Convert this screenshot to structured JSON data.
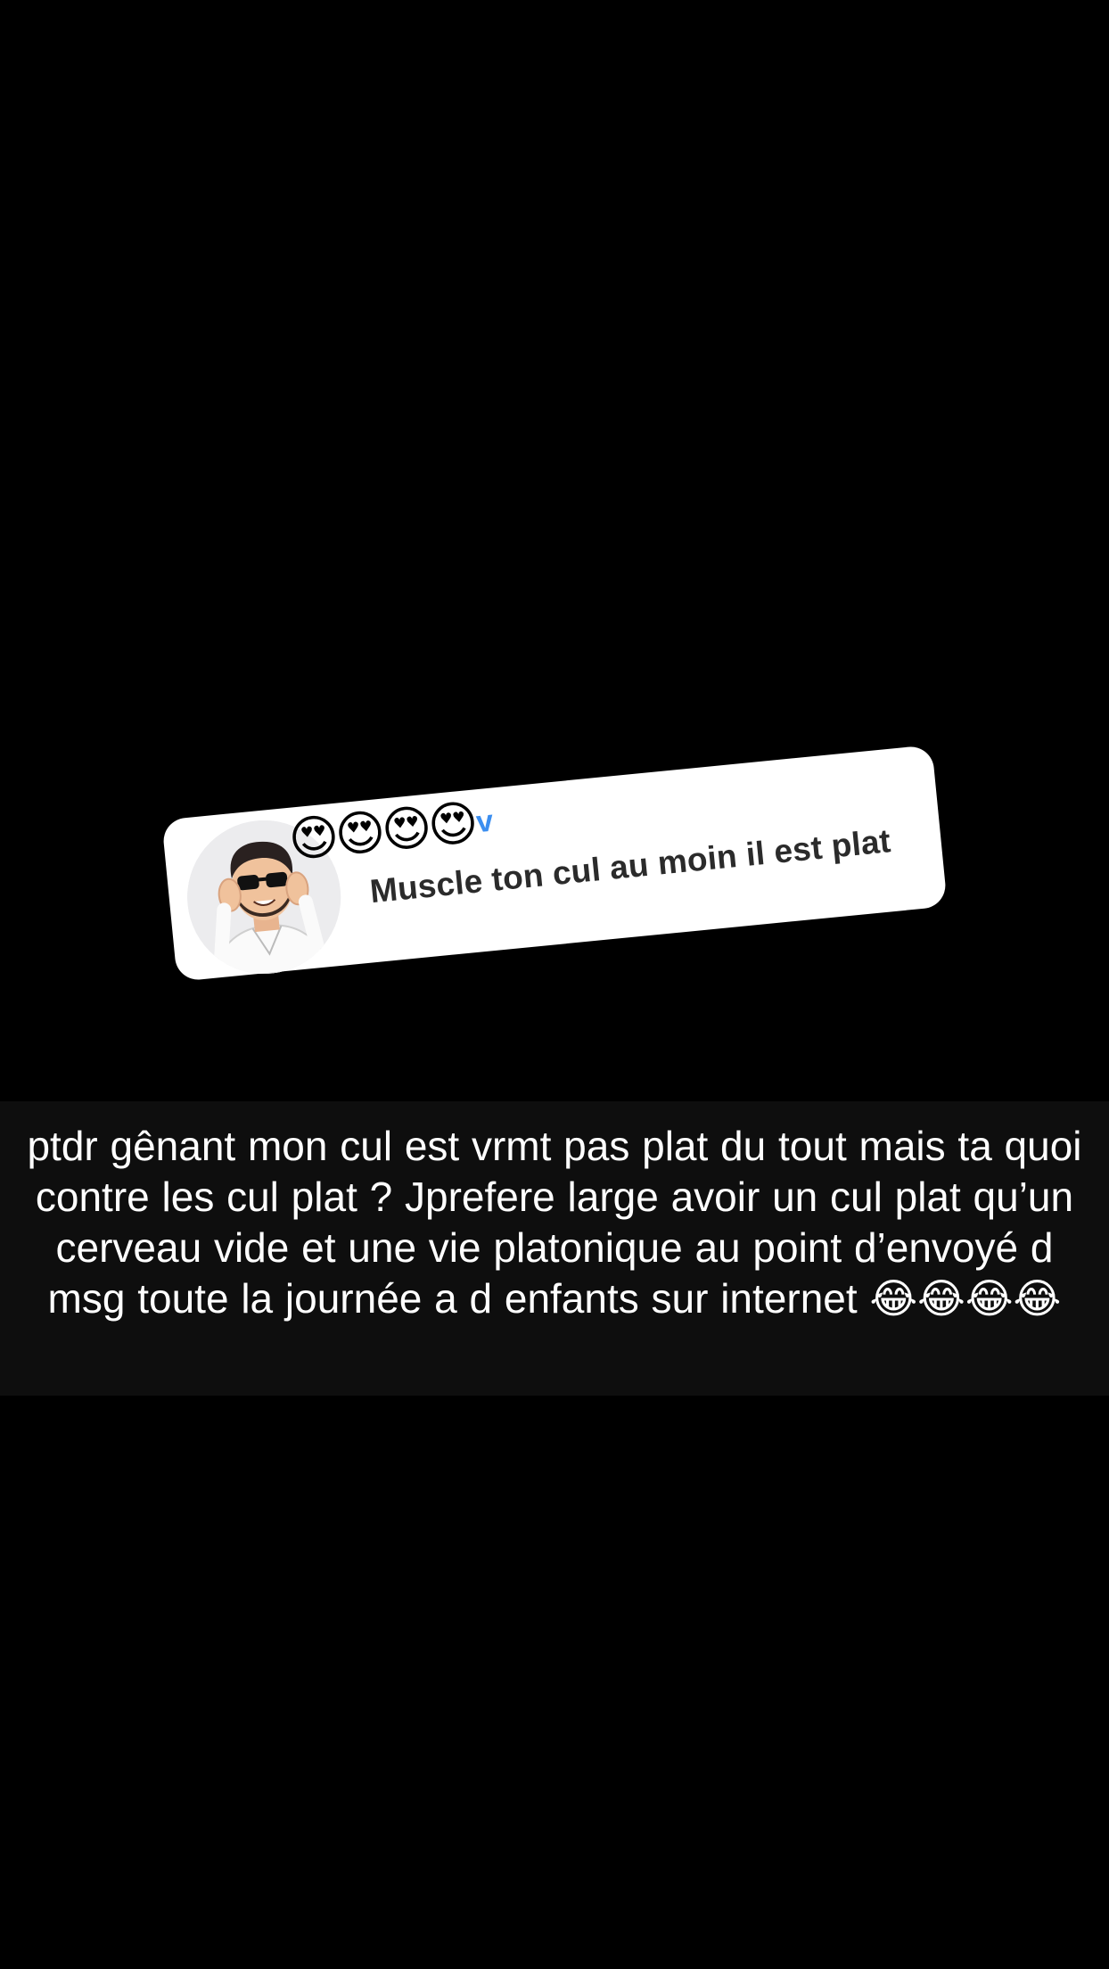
{
  "reply_sticker": {
    "username_emojis": [
      "😍",
      "😍",
      "😍",
      "😍"
    ],
    "username_suffix": "v",
    "question": "Muscle ton cul au moin il est plat"
  },
  "caption": {
    "text": "ptdr gênant mon cul est vrmt pas plat du tout mais ta quoi contre les cul plat ? Jprefere large avoir un cul plat qu’un cerveau vide et une vie platonique au point d’envoyé d msg toute la journée a d enfants sur internet",
    "emojis": "😂😂😂😂"
  },
  "colors": {
    "background": "#000000",
    "card": "#ffffff",
    "question_text": "#2b2b2b",
    "username_accent": "#3b8ef0",
    "caption_text": "#ffffff"
  },
  "icons": {
    "avatar": "bitmoji-avatar-man-sunglasses"
  }
}
